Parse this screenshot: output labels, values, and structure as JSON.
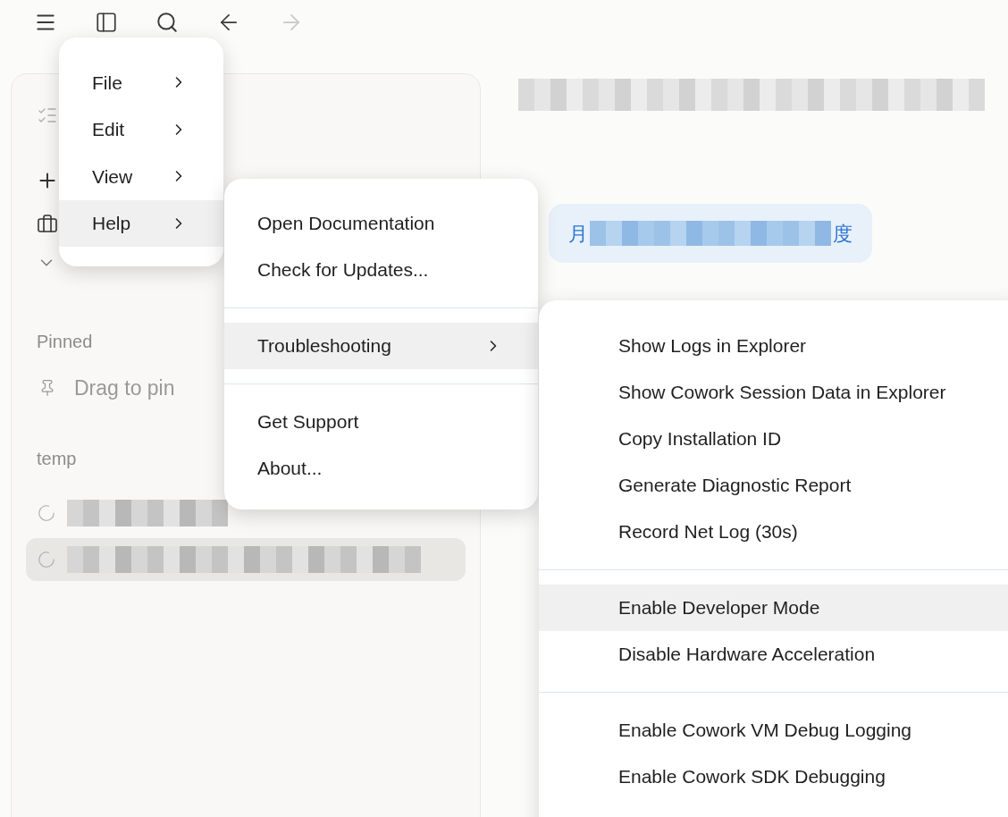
{
  "toolbar": {
    "forward_disabled": true
  },
  "sidebar": {
    "pinned_heading": "Pinned",
    "drag_hint": "Drag to pin",
    "project_heading": "temp",
    "recents": [
      {
        "selected": false
      },
      {
        "selected": true
      }
    ]
  },
  "conversation": {
    "bubble_start": "月",
    "bubble_end": "度"
  },
  "main_menu": [
    {
      "label": "File",
      "submenu": true,
      "selected": false
    },
    {
      "label": "Edit",
      "submenu": true,
      "selected": false
    },
    {
      "label": "View",
      "submenu": true,
      "selected": false
    },
    {
      "label": "Help",
      "submenu": true,
      "selected": true
    }
  ],
  "help_menu": [
    [
      {
        "label": "Open Documentation",
        "submenu": false,
        "selected": false
      },
      {
        "label": "Check for Updates...",
        "submenu": false,
        "selected": false
      }
    ],
    [
      {
        "label": "Troubleshooting",
        "submenu": true,
        "selected": true
      }
    ],
    [
      {
        "label": "Get Support",
        "submenu": false,
        "selected": false
      },
      {
        "label": "About...",
        "submenu": false,
        "selected": false
      }
    ]
  ],
  "troubleshooting_menu": [
    [
      {
        "label": "Show Logs in Explorer",
        "submenu": false,
        "selected": false
      },
      {
        "label": "Show Cowork Session Data in Explorer",
        "submenu": false,
        "selected": false
      },
      {
        "label": "Copy Installation ID",
        "submenu": false,
        "selected": false
      },
      {
        "label": "Generate Diagnostic Report",
        "submenu": false,
        "selected": false
      },
      {
        "label": "Record Net Log (30s)",
        "submenu": false,
        "selected": false
      }
    ],
    [
      {
        "label": "Enable Developer Mode",
        "submenu": false,
        "selected": true
      },
      {
        "label": "Disable Hardware Acceleration",
        "submenu": false,
        "selected": false
      }
    ],
    [
      {
        "label": "Enable Cowork VM Debug Logging",
        "submenu": false,
        "selected": false
      },
      {
        "label": "Enable Cowork SDK Debugging",
        "submenu": false,
        "selected": false
      }
    ]
  ]
}
